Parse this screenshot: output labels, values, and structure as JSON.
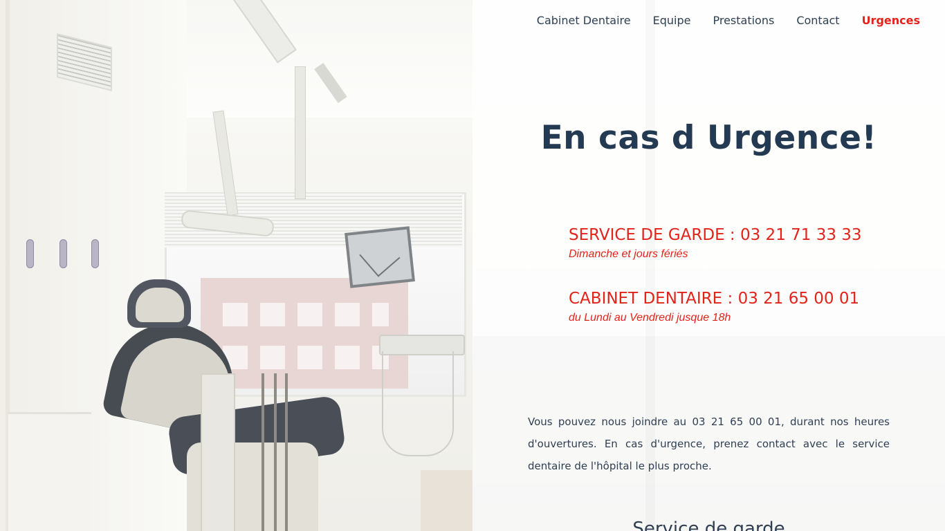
{
  "nav": {
    "items": [
      {
        "label": "Cabinet Dentaire"
      },
      {
        "label": "Equipe"
      },
      {
        "label": "Prestations"
      },
      {
        "label": "Contact"
      },
      {
        "label": "Urgences"
      }
    ],
    "active_index": 4
  },
  "hero": {
    "title": "En cas d Urgence!"
  },
  "phones": [
    {
      "title": "SERVICE DE GARDE : 03 21 71 33 33",
      "subtitle": "Dimanche et jours fériés"
    },
    {
      "title": "CABINET DENTAIRE : 03 21 65 00 01",
      "subtitle": "du Lundi au Vendredi jusque 18h"
    }
  ],
  "info": {
    "paragraph": "Vous pouvez nous joindre au 03 21 65 00 01, durant nos heures d'ouvertures. En cas d'urgence, prenez contact avec le service dentaire de l'hôpital le plus proche."
  },
  "section": {
    "heading": "Service de garde"
  },
  "colors": {
    "accent_red": "#e2231a",
    "navy": "#233a52",
    "text": "#2e3f52"
  },
  "photo": {
    "subject": "dental-office-photo"
  }
}
